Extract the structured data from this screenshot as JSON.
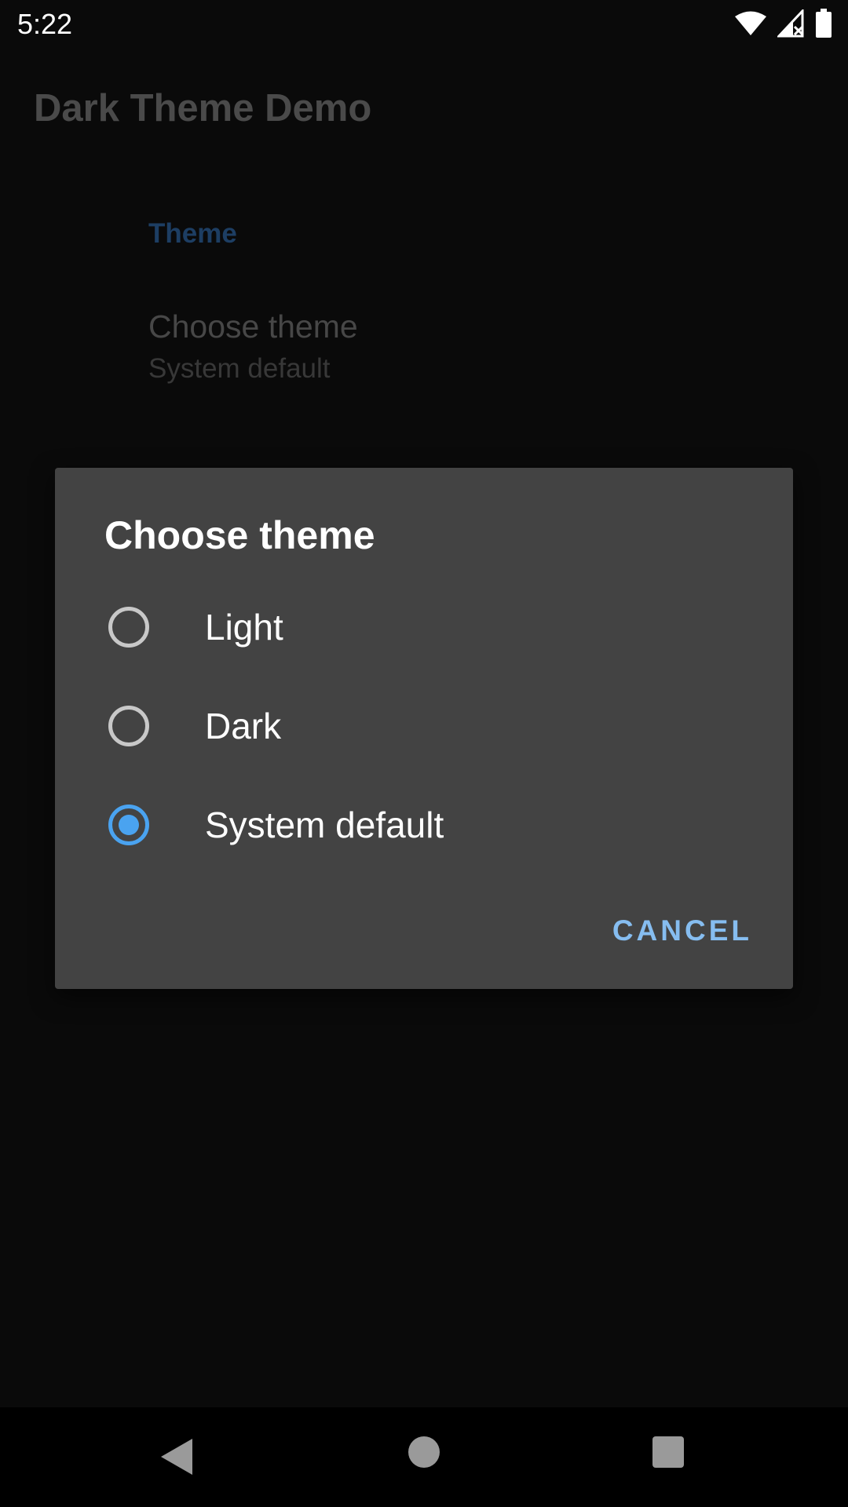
{
  "status_bar": {
    "time": "5:22",
    "icons": [
      "wifi-icon",
      "signal-icon",
      "battery-icon"
    ]
  },
  "app": {
    "title": "Dark Theme Demo",
    "category": "Theme",
    "preference": {
      "title": "Choose theme",
      "summary": "System default"
    }
  },
  "dialog": {
    "title": "Choose theme",
    "options": [
      {
        "label": "Light",
        "checked": false
      },
      {
        "label": "Dark",
        "checked": false
      },
      {
        "label": "System default",
        "checked": true
      }
    ],
    "cancel_label": "CANCEL"
  },
  "nav_bar": {
    "icons": [
      "back-icon",
      "home-icon",
      "recents-icon"
    ]
  },
  "colors": {
    "accent": "#4aa3f0",
    "dialog_background": "#434343",
    "button_text": "#86bdf0"
  }
}
